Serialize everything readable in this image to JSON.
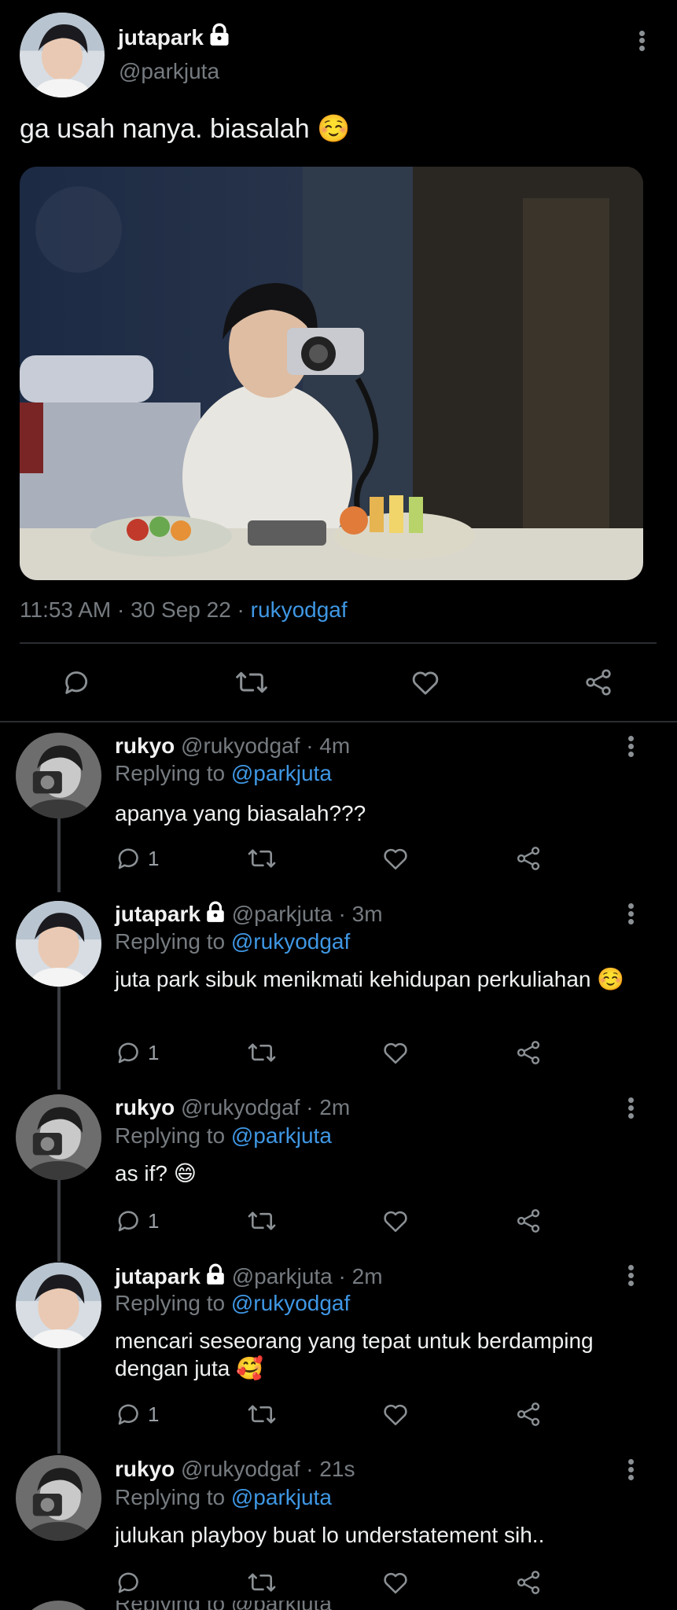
{
  "main_tweet": {
    "display_name": "jutapark",
    "handle": "@parkjuta",
    "text": "ga usah nanya. biasalah ☺️",
    "timestamp": "11:53 AM · 30 Sep 22 · ",
    "source": "rukyodgaf"
  },
  "replies": [
    {
      "display_name": "rukyo",
      "handle_time": "@rukyodgaf · 4m",
      "replying_prefix": "Replying to ",
      "replying_to": "@parkjuta",
      "text": "apanya yang biasalah???",
      "reply_count": "1"
    },
    {
      "display_name": "jutapark",
      "handle_time": "@parkjuta · 3m",
      "replying_prefix": "Replying to ",
      "replying_to": "@rukyodgaf",
      "text": "juta park sibuk menikmati kehidupan perkuliahan ☺️",
      "reply_count": "1"
    },
    {
      "display_name": "rukyo",
      "handle_time": "@rukyodgaf · 2m",
      "replying_prefix": "Replying to ",
      "replying_to": "@parkjuta",
      "text": "as if? 😄",
      "reply_count": "1"
    },
    {
      "display_name": "jutapark",
      "handle_time": "@parkjuta · 2m",
      "replying_prefix": "Replying to ",
      "replying_to": "@rukyodgaf",
      "text": "mencari seseorang yang tepat untuk berdamping dengan juta 🥰",
      "reply_count": "1"
    },
    {
      "display_name": "rukyo",
      "handle_time": "@rukyodgaf · 21s",
      "replying_prefix": "Replying to ",
      "replying_to": "@parkjuta",
      "text": "julukan playboy buat lo understatement sih..",
      "reply_count": ""
    }
  ],
  "cutoff_text": "Replying to @parkjuta",
  "icons": {
    "reply": "reply-icon",
    "retweet": "retweet-icon",
    "like": "heart-icon",
    "share": "share-icon",
    "more": "more-vertical-icon",
    "lock": "lock-icon"
  },
  "colors": {
    "background": "#000000",
    "link": "#3f97e4",
    "muted": "#767b80"
  }
}
